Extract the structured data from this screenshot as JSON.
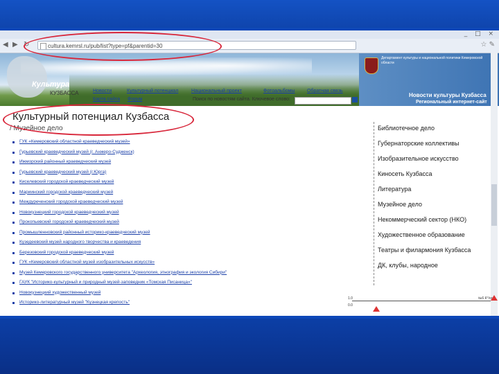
{
  "browser": {
    "url": "cultura.kemrsl.ru/pub/list?type=pf&parentid=30",
    "window_controls": "_ □ ×"
  },
  "header": {
    "logo_word": "Культура",
    "logo_sub": "КУЗБАССА",
    "dept_text": "Департамент культуры и национальной политики Кемеровской области",
    "title": "Новости культуры Кузбасса",
    "subtitle": "Региональный интернет-сайт"
  },
  "nav": {
    "items": [
      "Новости",
      "Культурный потенциал",
      "Национальный проект",
      "Фотоальбомы",
      "Обратная связь"
    ],
    "items2": [
      "Карта сайта",
      "Форум"
    ],
    "search_label": "Поиск по новостям сайта. Ключевое слово:",
    "search_value": ""
  },
  "page": {
    "title": "Культурный потенциал Кузбасса",
    "breadcrumb": "/ Музейное дело"
  },
  "museums": [
    "ГУК «Кемеровский областной краеведческий музей»",
    "Гурьевский краеведческий музей (г. Анжеро-Судженск)",
    "Ижморский районный краеведческий музей",
    "Гурьевский краеведческий музей (г.Юрга)",
    "Киселевский городской краеведческий музей",
    "Мариинский городской краеведческий музей",
    "Междуреченский городской краеведческий музей",
    "Новокузнецкий городской краеведческий музей",
    "Прокопьевский городской краеведческий музей",
    "Промышленновский районный историко-краеведческий музей",
    "Кузедеевский музей народного творчества и краеведения",
    "Березовский городской краеведческий музей",
    "ГУК «Кемеровский областной музей изобразительных искусств»",
    "Музей Кемеровского государственного университета \"Археология, этнография и экология Сибири\"",
    "ГАУК \"Историко-культурный и природный музей-заповедник «Томская Писаница»\"",
    "Новокузнецкий художественный музей",
    "Историко-литературный музей \"Кузнецкая крепость\""
  ],
  "categories": [
    "Библиотечное дело",
    "Губернаторские коллективы",
    "Изобразительное искусство",
    "Киносеть Кузбасса",
    "Литература",
    "Музейное дело",
    "Некоммерческий сектор (НКО)",
    "Художественное образование",
    "Театры и филармония Кузбасса",
    "ДК, клубы, народное"
  ],
  "ruler": {
    "left_label": "1.0",
    "mid_label": "0.0",
    "right_label": "№6 К°/см"
  },
  "colors": {
    "slide_bg": "#0d47b8",
    "link": "#1a3fa8",
    "highlight": "#d8263a"
  }
}
